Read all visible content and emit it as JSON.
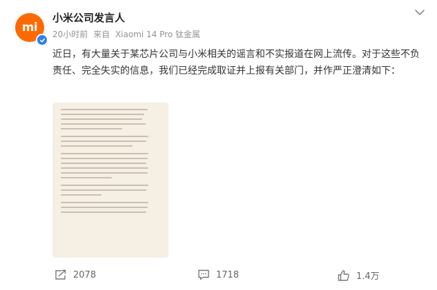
{
  "author": {
    "name": "小米公司发言人",
    "avatar_text": "mi",
    "verified": true
  },
  "meta": {
    "time": "20小时前",
    "source_prefix": "来自",
    "source": "Xiaomi 14 Pro 钛金属"
  },
  "post": {
    "text": "近日，有大量关于某芯片公司与小米相关的谣言和不实报道在网上流传。对于这些不负责任、完全失实的信息，我们已经完成取证并上报有关部门，并作严正澄清如下："
  },
  "image": {
    "description_icon": "document-image"
  },
  "actions": {
    "repost_count": "2078",
    "comment_count": "1718",
    "like_count": "1.4万"
  },
  "colors": {
    "brand": "#ff6900",
    "verified": "#2f7ef2",
    "meta_text": "#939393",
    "doc_background": "#f6efe4"
  }
}
